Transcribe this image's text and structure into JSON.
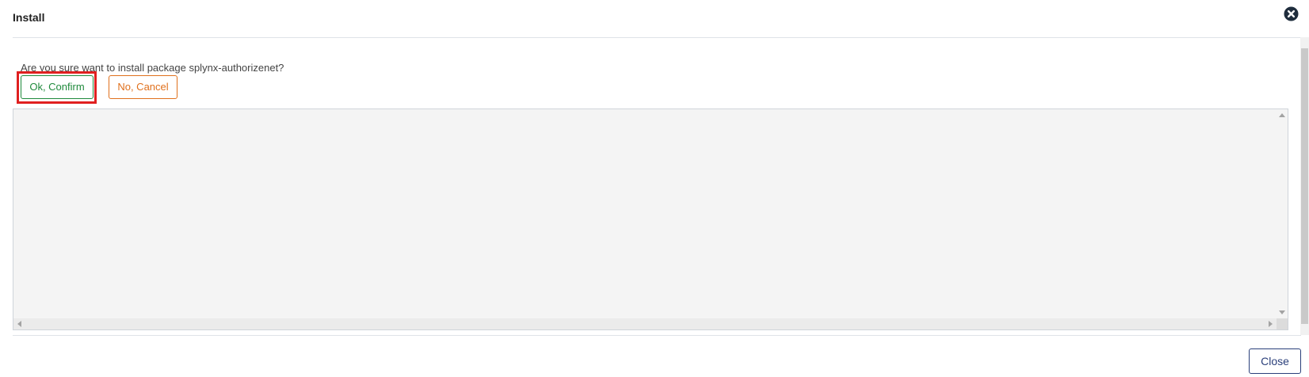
{
  "dialog": {
    "title": "Install",
    "prompt": "Are you sure want to install package splynx-authorizenet?",
    "confirm_label": "Ok, Confirm",
    "cancel_label": "No, Cancel",
    "close_label": "Close",
    "log_output": ""
  },
  "icons": {
    "close": "close-circle-icon"
  },
  "colors": {
    "confirm": "#1f8a3c",
    "cancel": "#e0701c",
    "close": "#2a3f7a",
    "highlight": "#e02020",
    "log_background": "#f4f4f4"
  }
}
